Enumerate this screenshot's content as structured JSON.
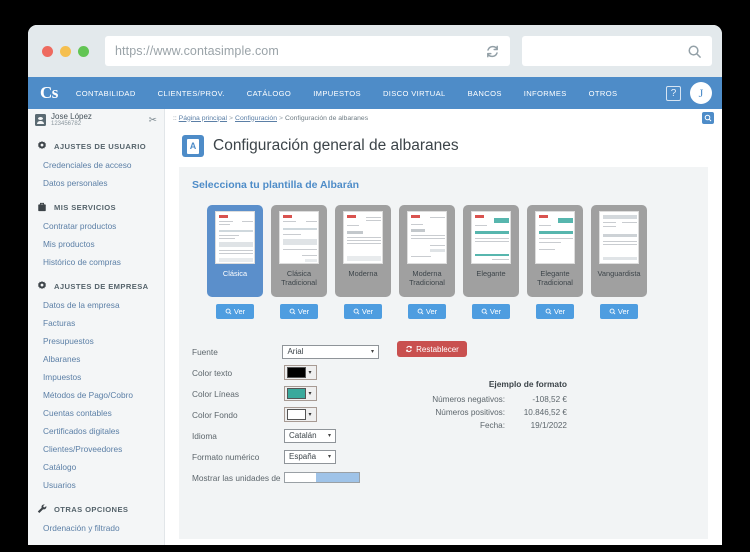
{
  "browser": {
    "url": "https://www.contasimple.com",
    "search_value": "",
    "reload_icon": "reload-icon",
    "search_icon": "search-icon"
  },
  "topnav": {
    "logo": "Cs",
    "items": [
      {
        "label": "CONTABILIDAD"
      },
      {
        "label": "CLIENTES/PROV."
      },
      {
        "label": "CATÁLOGO"
      },
      {
        "label": "IMPUESTOS"
      },
      {
        "label": "DISCO VIRTUAL"
      },
      {
        "label": "BANCOS"
      },
      {
        "label": "INFORMES"
      },
      {
        "label": "OTROS"
      }
    ],
    "help_label": "?",
    "avatar_letter": "J"
  },
  "sidebar": {
    "user": {
      "name": "Jose López",
      "number": "123456782",
      "collapse_icon": "scissors-icon"
    },
    "sections": [
      {
        "title": "AJUSTES DE USUARIO",
        "icon": "gear-icon",
        "items": [
          {
            "label": "Credenciales de acceso"
          },
          {
            "label": "Datos personales"
          }
        ]
      },
      {
        "title": "MIS SERVICIOS",
        "icon": "briefcase-icon",
        "items": [
          {
            "label": "Contratar productos"
          },
          {
            "label": "Mis productos"
          },
          {
            "label": "Histórico de compras"
          }
        ]
      },
      {
        "title": "AJUSTES DE EMPRESA",
        "icon": "gear-icon",
        "items": [
          {
            "label": "Datos de la empresa"
          },
          {
            "label": "Facturas"
          },
          {
            "label": "Presupuestos"
          },
          {
            "label": "Albaranes"
          },
          {
            "label": "Impuestos"
          },
          {
            "label": "Métodos de Pago/Cobro"
          },
          {
            "label": "Cuentas contables"
          },
          {
            "label": "Certificados digitales"
          },
          {
            "label": "Clientes/Proveedores"
          },
          {
            "label": "Catálogo"
          },
          {
            "label": "Usuarios"
          }
        ]
      },
      {
        "title": "OTRAS OPCIONES",
        "icon": "wrench-icon",
        "items": [
          {
            "label": "Ordenación y filtrado"
          }
        ]
      }
    ]
  },
  "breadcrumb": {
    "prefix": ":: ",
    "home": "Página principal",
    "section": "Configuración",
    "current": "Configuración de albaranes",
    "separator": ">",
    "search_icon": "magnifier-icon"
  },
  "page": {
    "title": "Configuración general de albaranes",
    "icon": "document-icon",
    "icon_letter": "A"
  },
  "templates": {
    "heading": "Selecciona tu plantilla de Albarán",
    "view_label": "Ver",
    "view_icon": "magnifier-icon",
    "cards": [
      {
        "name": "Clásica",
        "selected": true
      },
      {
        "name": "Clásica Tradicional",
        "selected": false
      },
      {
        "name": "Moderna",
        "selected": false
      },
      {
        "name": "Moderna Tradicional",
        "selected": false
      },
      {
        "name": "Elegante",
        "selected": false
      },
      {
        "name": "Elegante Tradicional",
        "selected": false
      },
      {
        "name": "Vanguardista",
        "selected": false
      }
    ]
  },
  "form": {
    "font": {
      "label": "Fuente",
      "value": "Arial"
    },
    "text_color": {
      "label": "Color texto",
      "value": "#000000"
    },
    "line_color": {
      "label": "Color Líneas",
      "value": "#3aa99c"
    },
    "bg_color": {
      "label": "Color Fondo",
      "value": "#ffffff"
    },
    "language": {
      "label": "Idioma",
      "value": "Catalán"
    },
    "number_format": {
      "label": "Formato numérico",
      "value": "España"
    },
    "units_row": {
      "label": "Mostrar las unidades de"
    }
  },
  "actions": {
    "reset_label": "Restablecer",
    "reset_icon": "refresh-icon"
  },
  "format_example": {
    "title": "Ejemplo de formato",
    "rows": [
      {
        "label": "Números negativos:",
        "value": "-108,52 €"
      },
      {
        "label": "Números positivos:",
        "value": "10.846,52 €"
      },
      {
        "label": "Fecha:",
        "value": "19/1/2022"
      }
    ]
  },
  "colors": {
    "accent_blue": "#4e8cc8",
    "button_blue": "#4e9de0",
    "selected_card": "#5b8fcb",
    "reset_red": "#c9504f",
    "teal": "#3aa99c"
  }
}
